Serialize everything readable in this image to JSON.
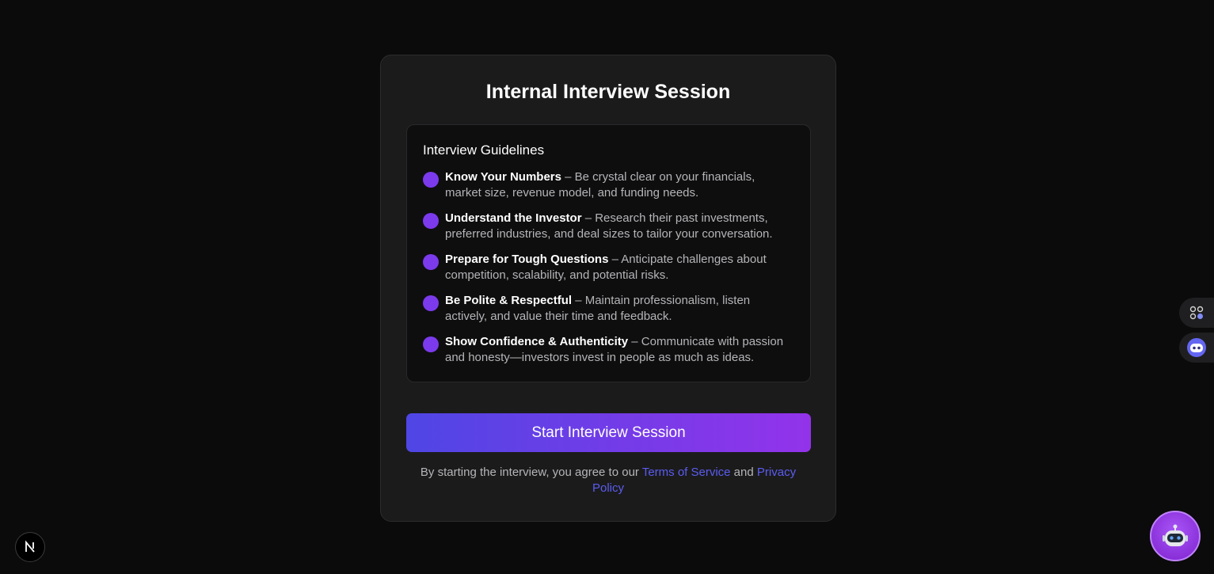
{
  "card": {
    "title": "Internal Interview Session",
    "guidelines": {
      "heading": "Interview Guidelines",
      "items": [
        {
          "bold": "Know Your Numbers",
          "text": " – Be crystal clear on your financials, market size, revenue model, and funding needs."
        },
        {
          "bold": "Understand the Investor",
          "text": " – Research their past investments, preferred industries, and deal sizes to tailor your conversation."
        },
        {
          "bold": "Prepare for Tough Questions",
          "text": " – Anticipate challenges about competition, scalability, and potential risks."
        },
        {
          "bold": "Be Polite & Respectful",
          "text": " – Maintain professionalism, listen actively, and value their time and feedback."
        },
        {
          "bold": "Show Confidence & Authenticity",
          "text": " – Communicate with passion and honesty—investors invest in people as much as ideas."
        }
      ]
    },
    "start_button": "Start Interview Session",
    "terms": {
      "prefix": "By starting the interview, you agree to our ",
      "terms_link": "Terms of Service",
      "middle": " and ",
      "privacy_link": "Privacy Policy"
    }
  },
  "icons": {
    "next_badge": "nextjs-logo-icon",
    "side_tab_1": "apps-grid-icon",
    "side_tab_2": "chat-bot-icon",
    "assistant": "robot-assistant-icon"
  },
  "colors": {
    "background": "#0b0b0b",
    "card": "#1b1b1c",
    "bullet": "#7c3aed",
    "button_start": "#4f46e5",
    "button_end": "#9333ea",
    "link": "#5b5cf0"
  }
}
